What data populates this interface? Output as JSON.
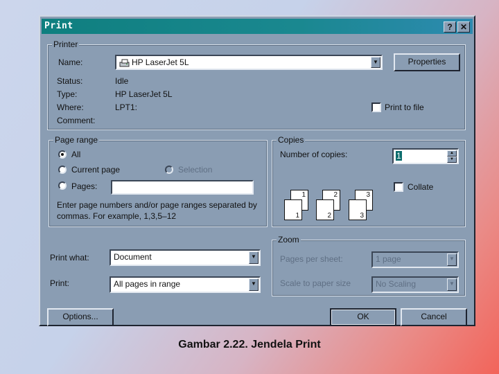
{
  "dialog": {
    "title": "Print",
    "help_button": "?",
    "close_button": "✕"
  },
  "printer": {
    "group_label": "Printer",
    "name_label": "Name:",
    "name_value": "HP LaserJet 5L",
    "properties_button": "Properties",
    "status_label": "Status:",
    "status_value": "Idle",
    "type_label": "Type:",
    "type_value": "HP LaserJet 5L",
    "where_label": "Where:",
    "where_value": "LPT1:",
    "comment_label": "Comment:",
    "comment_value": "",
    "print_to_file_label": "Print to file",
    "print_to_file_checked": false
  },
  "page_range": {
    "group_label": "Page range",
    "all_label": "All",
    "current_page_label": "Current page",
    "selection_label": "Selection",
    "pages_label": "Pages:",
    "pages_value": "",
    "selected": "All",
    "hint": "Enter page numbers and/or page ranges separated by commas.  For example, 1,3,5–12"
  },
  "copies": {
    "group_label": "Copies",
    "number_label": "Number of copies:",
    "number_value": "1",
    "collate_label": "Collate",
    "collate_checked": false,
    "page_icons": [
      {
        "front": "1",
        "back": "1"
      },
      {
        "front": "2",
        "back": "2"
      },
      {
        "front": "3",
        "back": "3"
      }
    ]
  },
  "print_what": {
    "label": "Print what:",
    "value": "Document"
  },
  "print": {
    "label": "Print:",
    "value": "All pages in range"
  },
  "zoom": {
    "group_label": "Zoom",
    "pages_per_sheet_label": "Pages per sheet:",
    "pages_per_sheet_value": "1 page",
    "scale_label": "Scale to paper size",
    "scale_value": "No Scaling"
  },
  "buttons": {
    "options": "Options...",
    "ok": "OK",
    "cancel": "Cancel"
  },
  "caption": "Gambar 2.22. Jendela Print"
}
